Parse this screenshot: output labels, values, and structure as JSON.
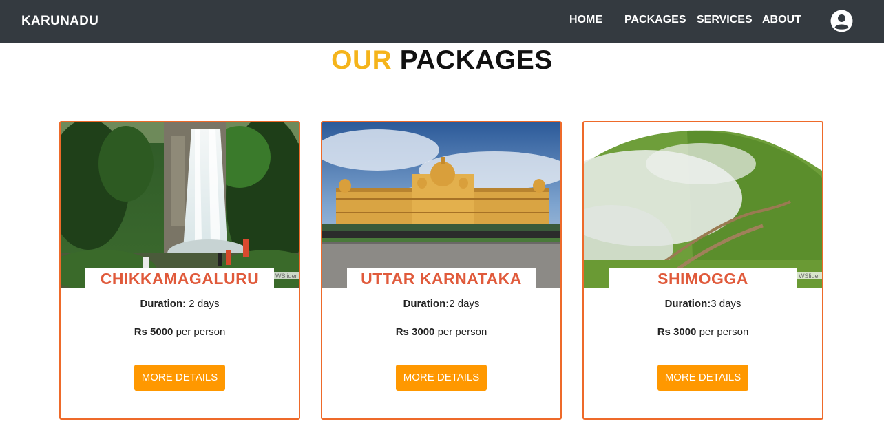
{
  "navbar": {
    "brand": "KARUNADU",
    "links": [
      {
        "label": "HOME"
      },
      {
        "label": "PACKAGES"
      },
      {
        "label": "SERVICES"
      },
      {
        "label": "ABOUT"
      }
    ],
    "user_icon": "user-circle-icon",
    "background": "#343a40"
  },
  "heading": {
    "accent": "OUR",
    "main": "PACKAGES",
    "accent_color": "#f5b41b"
  },
  "packages": [
    {
      "name": "CHIKKAMAGALURU",
      "duration_label": "Duration:",
      "duration_value": " 2 days",
      "price_label": "Rs 5000",
      "price_suffix": " per person",
      "button_label": "MORE DETAILS",
      "image": "waterfall-photo",
      "watermark": "WSlider"
    },
    {
      "name": "UTTAR KARNATAKA",
      "duration_label": "Duration:",
      "duration_value": "2 days",
      "price_label": "Rs 3000",
      "price_suffix": " per person",
      "button_label": "MORE DETAILS",
      "image": "palace-photo"
    },
    {
      "name": "SHIMOGGA",
      "duration_label": "Duration:",
      "duration_value": "3 days",
      "price_label": "Rs 3000",
      "price_suffix": " per person",
      "button_label": "MORE DETAILS",
      "image": "misty-hill-photo",
      "watermark": "WSlider"
    }
  ],
  "colors": {
    "card_border": "#ee6a2a",
    "package_name": "#e05a3b",
    "button": "#ff9800"
  }
}
